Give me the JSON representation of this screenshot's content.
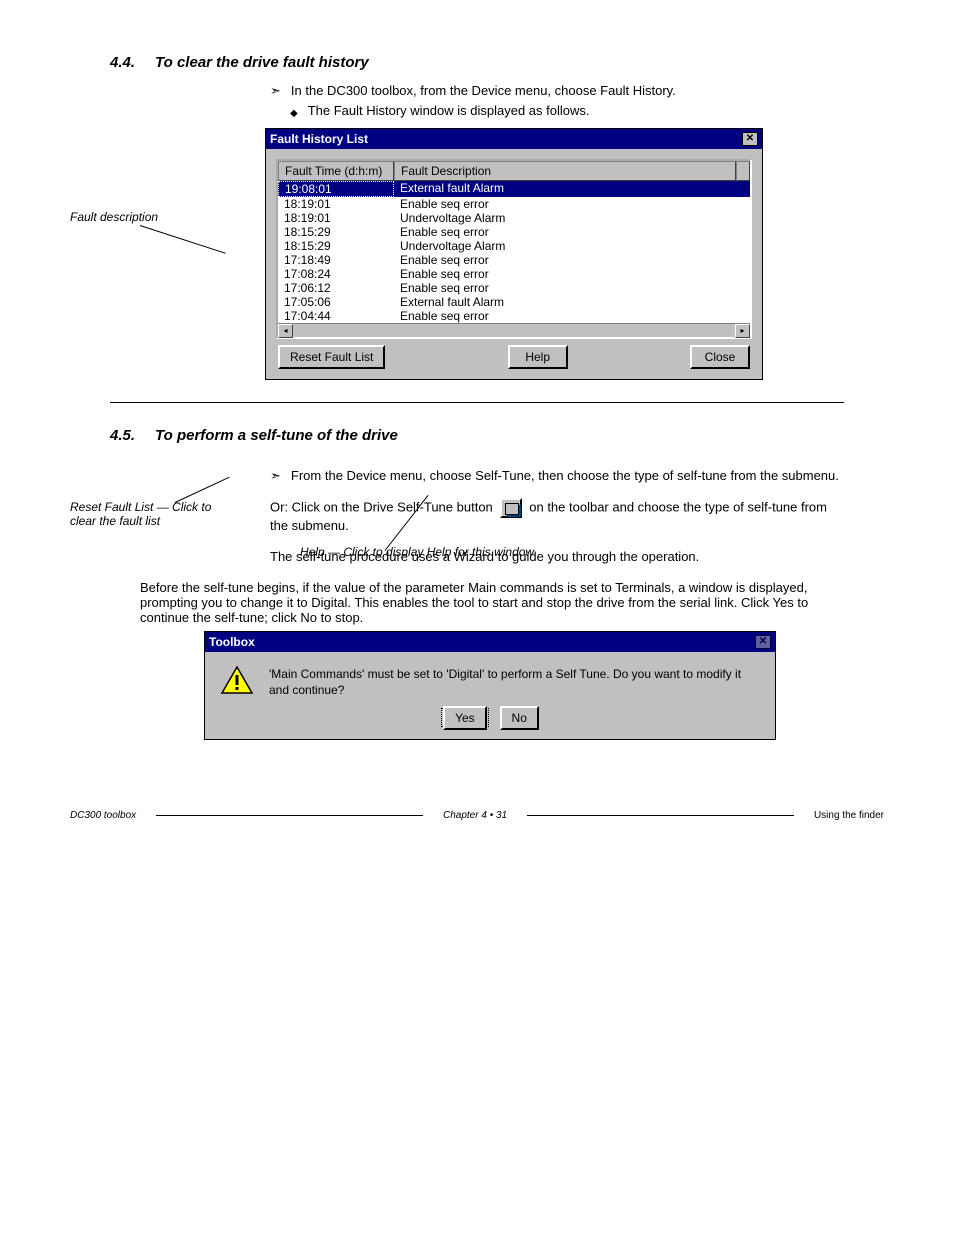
{
  "section1": {
    "heading_num": "4.4.",
    "heading_text": "To clear the drive fault history",
    "step1": "In the DC300 toolbox, from the Device menu, choose Fault History.",
    "step1b": "The Fault History window is displayed as follows."
  },
  "annotations": {
    "fault_desc": "Fault description",
    "reset_desc": "Reset Fault List — Click to clear the fault list",
    "help_desc": "Help — Click to display Help for this window"
  },
  "fault_dialog": {
    "title": "Fault History List",
    "col_time": "Fault Time (d:h:m)",
    "col_desc": "Fault Description",
    "rows": [
      {
        "time": "19:08:01",
        "desc": "External fault Alarm"
      },
      {
        "time": "18:19:01",
        "desc": "Enable seq error"
      },
      {
        "time": "18:19:01",
        "desc": "Undervoltage Alarm"
      },
      {
        "time": "18:15:29",
        "desc": "Enable seq error"
      },
      {
        "time": "18:15:29",
        "desc": "Undervoltage Alarm"
      },
      {
        "time": "17:18:49",
        "desc": "Enable seq error"
      },
      {
        "time": "17:08:24",
        "desc": "Enable seq error"
      },
      {
        "time": "17:06:12",
        "desc": "Enable seq error"
      },
      {
        "time": "17:05:06",
        "desc": "External fault Alarm"
      },
      {
        "time": "17:04:44",
        "desc": "Enable seq error"
      }
    ],
    "btn_reset": "Reset Fault List",
    "btn_help": "Help",
    "btn_close": "Close"
  },
  "section2": {
    "heading_num": "4.5.",
    "heading_text": "To perform a self-tune of the drive",
    "step1": "From the Device menu, choose Self-Tune, then choose the type of self-tune from the submenu.",
    "or": "Or: Click on the Drive Self-Tune button",
    "or_tail": " on the toolbar and choose the type of self-tune from the submenu.",
    "para2": "The self-tune procedure uses a Wizard to guide you through the operation.",
    "para3": "Before the self-tune begins, if the value of the parameter Main commands is set to Terminals, a window is displayed, prompting you to change it to Digital. This enables the tool to start and stop the drive from the serial link. Click Yes to continue the self-tune; click No to stop."
  },
  "toolbox_dialog": {
    "title": "Toolbox",
    "message": "'Main Commands' must be set to 'Digital' to perform a Self Tune. Do you want to modify it and continue?",
    "yes": "Yes",
    "no": "No"
  },
  "footer": {
    "left": "DC300 toolbox",
    "mid": "Chapter 4  •  31",
    "right": "Using the finder"
  }
}
